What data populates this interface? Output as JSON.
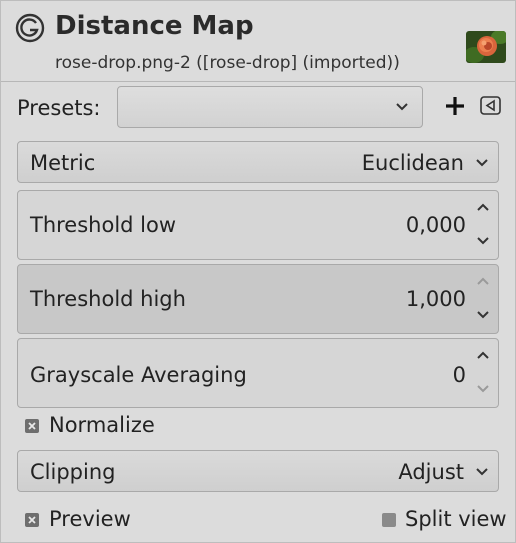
{
  "header": {
    "title": "Distance Map",
    "subtitle": "rose-drop.png-2 ([rose-drop] (imported))"
  },
  "presets": {
    "label": "Presets:",
    "value": "",
    "add_icon": "plus-icon",
    "menu_icon": "triangle-left-icon"
  },
  "metric": {
    "label": "Metric",
    "value": "Euclidean"
  },
  "threshold_low": {
    "label": "Threshold low",
    "value": "0,000"
  },
  "threshold_high": {
    "label": "Threshold high",
    "value": "1,000"
  },
  "grayscale_averaging": {
    "label": "Grayscale Averaging",
    "value": "0"
  },
  "normalize": {
    "label": "Normalize",
    "checked": true
  },
  "clipping": {
    "label": "Clipping",
    "value": "Adjust"
  },
  "preview": {
    "label": "Preview",
    "checked": true
  },
  "split_view": {
    "label": "Split view",
    "checked": false
  },
  "colors": {
    "background": "#dcdcdc",
    "border": "#a9a9a9",
    "text": "#222222"
  }
}
